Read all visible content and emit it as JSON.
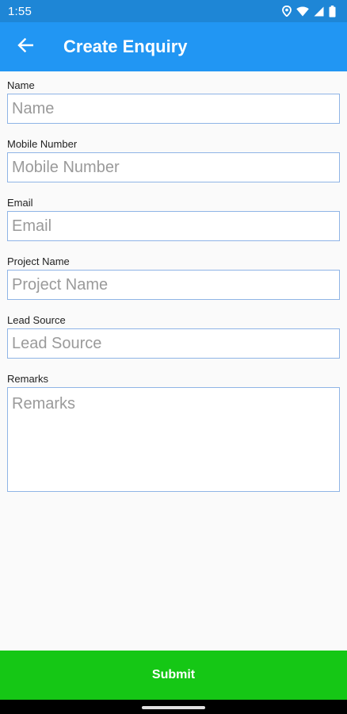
{
  "status_bar": {
    "time": "1:55",
    "icons": [
      "location-icon",
      "wifi-icon",
      "signal-icon",
      "battery-icon"
    ]
  },
  "app_bar": {
    "title": "Create Enquiry",
    "back_icon": "arrow-back-icon"
  },
  "form": {
    "fields": [
      {
        "label": "Name",
        "placeholder": "Name",
        "value": ""
      },
      {
        "label": "Mobile Number",
        "placeholder": "Mobile Number",
        "value": ""
      },
      {
        "label": "Email",
        "placeholder": "Email",
        "value": ""
      },
      {
        "label": "Project Name",
        "placeholder": "Project Name",
        "value": ""
      },
      {
        "label": "Lead Source",
        "placeholder": "Lead Source",
        "value": ""
      },
      {
        "label": "Remarks",
        "placeholder": "Remarks",
        "value": ""
      }
    ]
  },
  "submit": {
    "label": "Submit"
  },
  "colors": {
    "status_bar": "#1e86d6",
    "app_bar": "#2196f3",
    "submit": "#15c715",
    "input_border": "#8fb4e6"
  }
}
